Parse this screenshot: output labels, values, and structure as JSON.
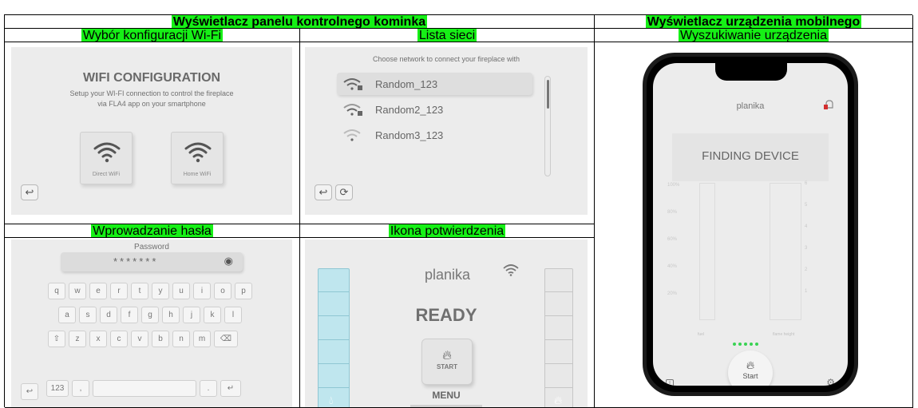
{
  "table": {
    "header_left": "Wyświetlacz panelu kontrolnego kominka",
    "header_right": "Wyświetlacz urządzenia mobilnego",
    "label_wifi_config": "Wybór konfiguracji Wi-Fi",
    "label_network_list": "Lista sieci",
    "label_device_search": "Wyszukiwanie urządzenia",
    "label_password": "Wprowadzanie hasła",
    "label_confirm": "Ikona potwierdzenia"
  },
  "wifi_config": {
    "title": "WIFI CONFIGURATION",
    "subtitle_line1": "Setup your WI-FI connection to control the fireplace",
    "subtitle_line2": "via FLA4 app on your smartphone",
    "direct_label": "Direct WiFi",
    "home_label": "Home WiFi",
    "back_icon": "back-arrow-icon"
  },
  "network_list": {
    "prompt": "Choose network to connect your fireplace with",
    "networks": [
      "Random_123",
      "Random2_123",
      "Random3_123"
    ],
    "back_icon": "back-arrow-icon",
    "refresh_icon": "refresh-icon"
  },
  "password": {
    "label": "Password",
    "masked_value": "*******",
    "eye_icon": "eye-icon",
    "row1": [
      "q",
      "w",
      "e",
      "r",
      "t",
      "y",
      "u",
      "i",
      "o",
      "p"
    ],
    "row2": [
      "a",
      "s",
      "d",
      "f",
      "g",
      "h",
      "j",
      "k",
      "l"
    ],
    "row3": [
      "z",
      "x",
      "c",
      "v",
      "b",
      "n",
      "m"
    ],
    "numbers_key": "123",
    "comma_key": ",",
    "period_key": ".",
    "shift_icon": "shift-icon",
    "backspace_icon": "backspace-icon",
    "enter_icon": "enter-icon"
  },
  "confirm": {
    "brand": "planika",
    "status": "READY",
    "start_label": "START",
    "menu_label": "MENU",
    "left_fill": 1.0,
    "right_fill": 0.0
  },
  "mobile": {
    "brand": "planika",
    "title": "FINDING DEVICE",
    "percent_ticks": [
      "100%",
      "80%",
      "60%",
      "40%",
      "20%"
    ],
    "right_ticks": [
      "6",
      "5",
      "4",
      "3",
      "2",
      "1"
    ],
    "left_caption": "fuel",
    "right_caption": "flame height",
    "progress_dots": 5,
    "start_label": "Start",
    "colors": {
      "accent_green": "#16f016",
      "alert_red": "#d32f2f",
      "dot_green": "#39d353"
    }
  }
}
